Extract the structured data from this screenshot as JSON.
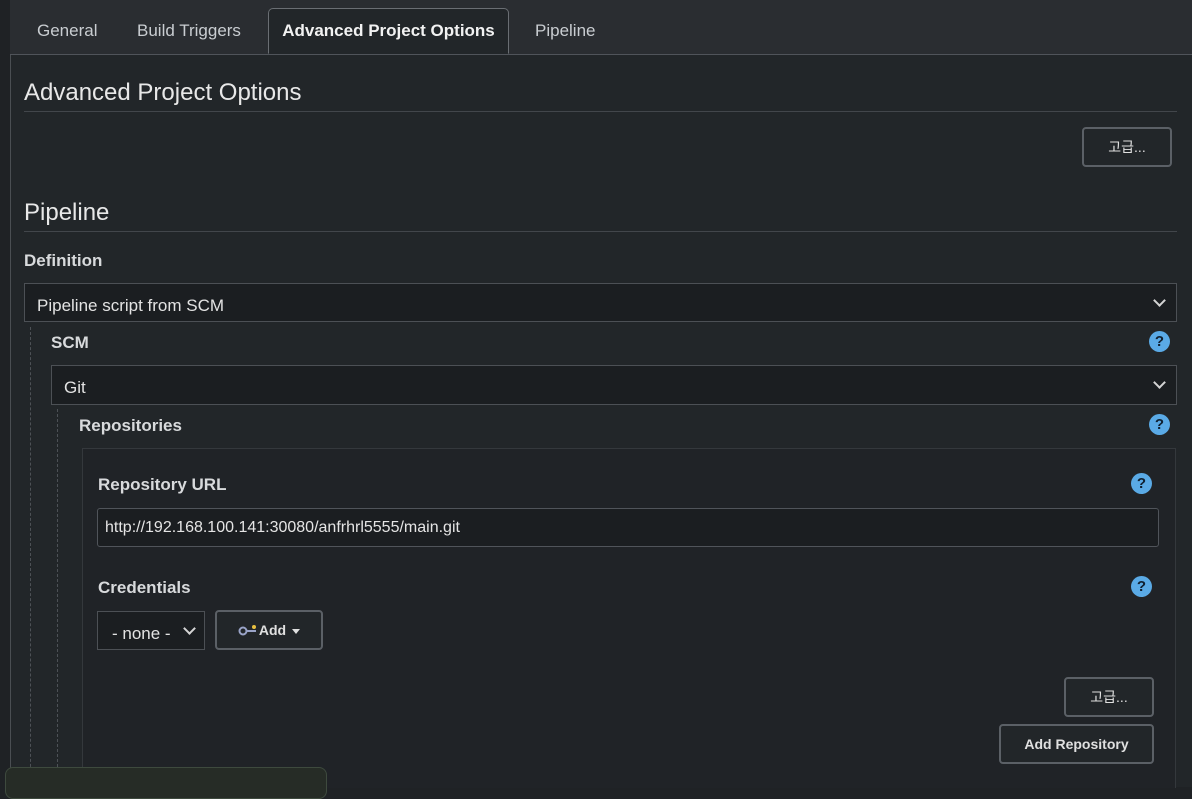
{
  "tabs": [
    {
      "label": "General"
    },
    {
      "label": "Build Triggers"
    },
    {
      "label": "Advanced Project Options"
    },
    {
      "label": "Pipeline"
    }
  ],
  "advanced": {
    "title": "Advanced Project Options",
    "advanced_button": "고급..."
  },
  "pipeline": {
    "title": "Pipeline",
    "definition_label": "Definition",
    "definition_value": "Pipeline script from SCM",
    "scm_label": "SCM",
    "scm_value": "Git",
    "repositories_label": "Repositories",
    "repo_url_label": "Repository URL",
    "repo_url_value": "http://192.168.100.141:30080/anfrhrl5555/main.git",
    "credentials_label": "Credentials",
    "credentials_value": "- none -",
    "add_label": "Add",
    "advanced_button": "고급...",
    "add_repository_button": "Add Repository",
    "help_glyph": "?"
  },
  "icons": {
    "help": "question-circle-icon",
    "key": "key-icon",
    "chevron": "chevron-down-icon"
  },
  "colors": {
    "help_icon": "#5aaae6",
    "background": "#222629"
  }
}
